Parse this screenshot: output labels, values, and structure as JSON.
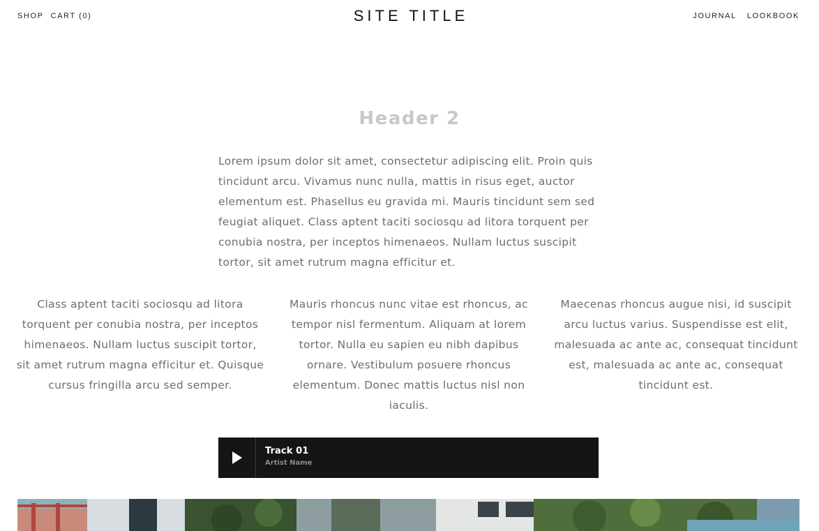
{
  "header": {
    "left_links": [
      "Shop",
      "Cart (0)"
    ],
    "site_title": "SITE TITLE",
    "right_links": [
      "Journal",
      "Lookbook"
    ]
  },
  "main": {
    "heading": "Header 2",
    "intro": "Lorem ipsum dolor sit amet, consectetur adipiscing elit. Proin quis tincidunt arcu. Vivamus nunc nulla, mattis in risus eget, auctor elementum est. Phasellus eu gravida mi. Mauris tincidunt sem sed feugiat aliquet. Class aptent taciti sociosqu ad litora torquent per conubia nostra, per inceptos himenaeos. Nullam luctus suscipit tortor, sit amet rutrum magna efficitur et.",
    "columns": [
      "Class aptent taciti sociosqu ad litora torquent per conubia nostra, per inceptos himenaeos. Nullam luctus suscipit tortor, sit amet rutrum magna efficitur et. Quisque cursus fringilla arcu sed semper.",
      "Mauris rhoncus nunc vitae est rhoncus, ac tempor nisl fermentum. Aliquam at lorem tortor. Nulla eu sapien eu nibh dapibus ornare. Vestibulum posuere rhoncus elementum. Donec mattis luctus nisl non iaculis.",
      "Maecenas rhoncus augue nisi, id suscipit arcu luctus varius. Suspendisse est elit, malesuada ac ante ac, consequat tincidunt est, malesuada ac ante ac, consequat tincidunt est."
    ]
  },
  "player": {
    "play_icon": "play-icon",
    "track_title": "Track 01",
    "artist": "Artist Name",
    "background": "#151515"
  },
  "colors": {
    "heading": "#c8c8c8",
    "body_text": "#6d6d6d",
    "nav_text": "#222222"
  }
}
